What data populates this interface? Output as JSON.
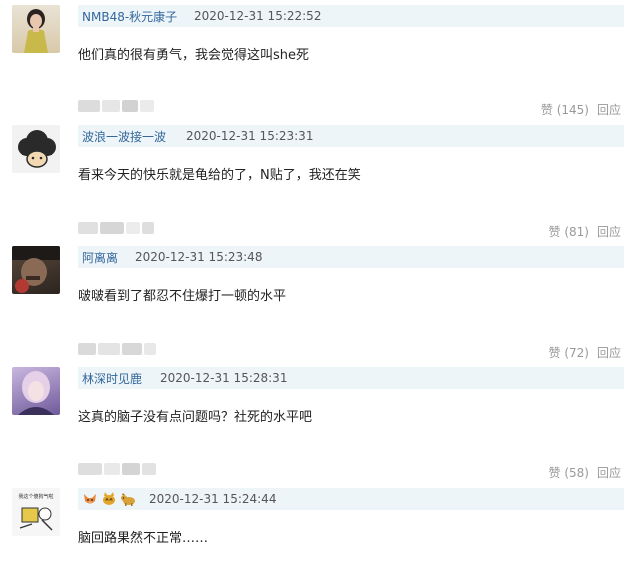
{
  "comments": [
    {
      "username": "NMB48-秋元康子",
      "timestamp": "2020-12-31 15:22:52",
      "content": "他们真的很有勇气，我会觉得这叫she死",
      "likes": "赞 (145)",
      "reply": "回应"
    },
    {
      "username": "波浪一波接一波",
      "timestamp": "2020-12-31 15:23:31",
      "content": "看来今天的快乐就是龟给的了，N贴了，我还在笑",
      "likes": "赞 (81)",
      "reply": "回应"
    },
    {
      "username": "阿离离",
      "timestamp": "2020-12-31 15:23:48",
      "content": "啵啵看到了都忍不住爆打一顿的水平",
      "likes": "赞 (72)",
      "reply": "回应"
    },
    {
      "username": "林深时见鹿",
      "timestamp": "2020-12-31 15:28:31",
      "content": "这真的脑子没有点问题吗？社死的水平吧",
      "likes": "赞 (58)",
      "reply": "回应"
    },
    {
      "username_icons": [
        "fox-emoji-icon",
        "cat-emoji-icon",
        "dog-emoji-icon"
      ],
      "avatar_caption": "我这个傻狗气啦",
      "timestamp": "2020-12-31 15:24:44",
      "content": "脑回路果然不正常……"
    }
  ],
  "colors": {
    "username": "#33669a",
    "header_bg": "#eef5f9",
    "muted": "#999999"
  }
}
